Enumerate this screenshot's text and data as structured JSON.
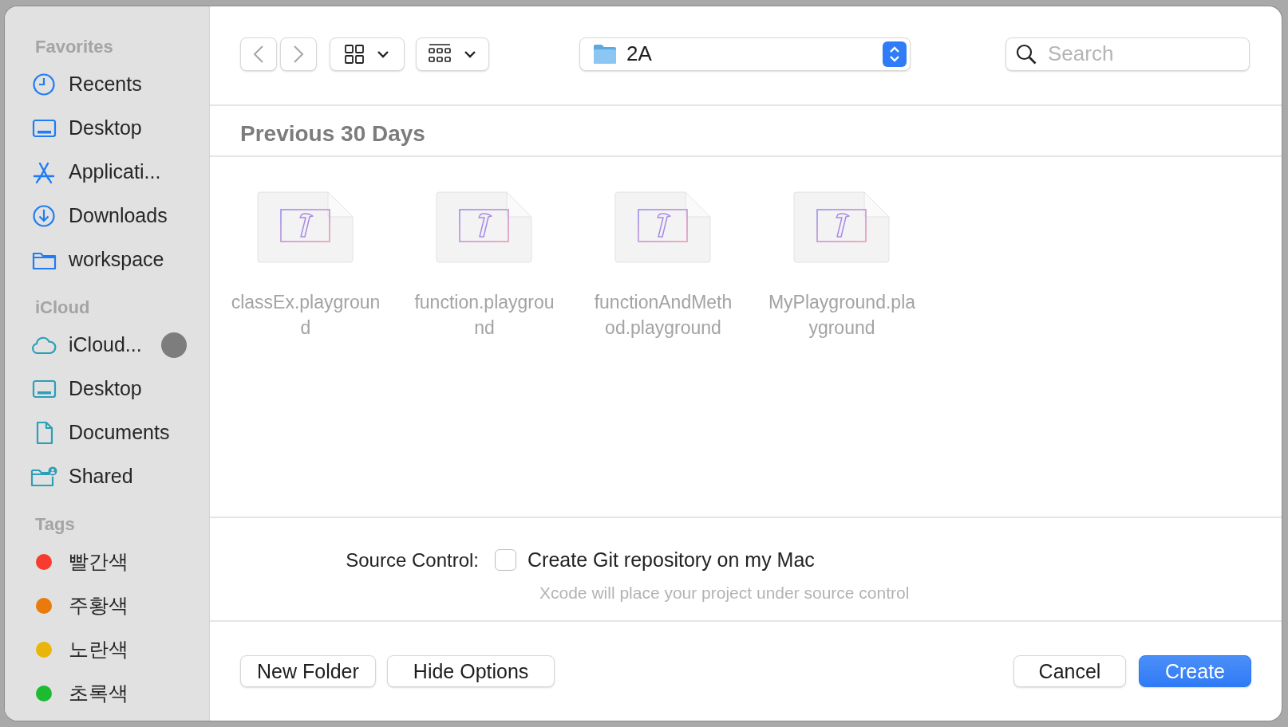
{
  "sidebar": {
    "sections": [
      {
        "title": "Favorites",
        "kind": "favorites",
        "items": [
          {
            "label": "Recents",
            "kind": "clock"
          },
          {
            "label": "Desktop",
            "kind": "desktop"
          },
          {
            "label": "Applicati...",
            "kind": "apps"
          },
          {
            "label": "Downloads",
            "kind": "download"
          },
          {
            "label": "workspace",
            "kind": "folder"
          }
        ]
      },
      {
        "title": "iCloud",
        "kind": "icloud",
        "items": [
          {
            "label": "iCloud...",
            "kind": "cloud",
            "syncing": true
          },
          {
            "label": "Desktop",
            "kind": "desktop"
          },
          {
            "label": "Documents",
            "kind": "document"
          },
          {
            "label": "Shared",
            "kind": "shared"
          }
        ]
      },
      {
        "title": "Tags",
        "kind": "tags",
        "items": [
          {
            "label": "빨간색",
            "kind": "tag",
            "color": "#f73b2e"
          },
          {
            "label": "주황색",
            "kind": "tag",
            "color": "#e87b0c"
          },
          {
            "label": "노란색",
            "kind": "tag",
            "color": "#eab50a"
          },
          {
            "label": "초록색",
            "kind": "tag",
            "color": "#1cbb30"
          }
        ]
      }
    ]
  },
  "toolbar": {
    "location": "2A",
    "search": {
      "placeholder": "Search"
    }
  },
  "section_header": "Previous 30 Days",
  "files": [
    {
      "lines": [
        "classEx.playgroun",
        "d"
      ]
    },
    {
      "lines": [
        "function.playgrou",
        "nd"
      ]
    },
    {
      "lines": [
        "functionAndMeth",
        "od.playground"
      ]
    },
    {
      "lines": [
        "MyPlayground.pla",
        "yground"
      ]
    }
  ],
  "options": {
    "label": "Source Control:",
    "checkbox": {
      "label": "Create Git repository on my Mac",
      "checked": false
    },
    "hint": "Xcode will place your project under source control"
  },
  "buttons_left": [
    "New Folder",
    "Hide Options"
  ],
  "buttons_right": [
    {
      "label": "Cancel",
      "kind": "secondary"
    },
    {
      "label": "Create",
      "kind": "primary"
    }
  ]
}
